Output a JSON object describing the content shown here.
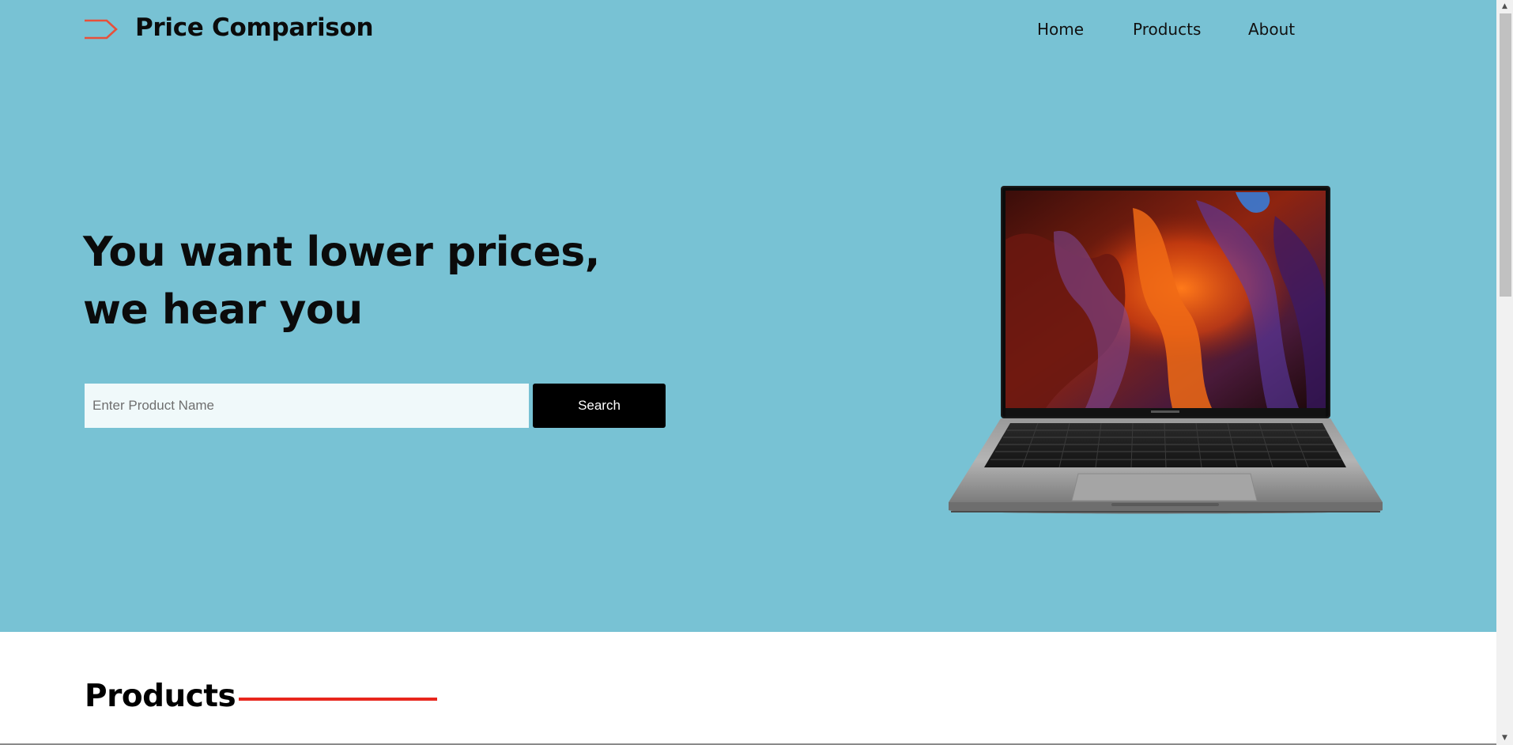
{
  "brand": {
    "name": "Price Comparison",
    "icon": "tag-outline-icon",
    "icon_color": "#e8503a"
  },
  "nav": {
    "items": [
      {
        "label": "Home"
      },
      {
        "label": "Products"
      },
      {
        "label": "About"
      }
    ]
  },
  "hero": {
    "background": "#78c2d4",
    "headline_line1": "You want lower prices,",
    "headline_line2": "we hear you",
    "search": {
      "placeholder": "Enter Product Name",
      "value": "",
      "button_label": "Search"
    },
    "image": "laptop-product-image"
  },
  "products": {
    "heading": "Products",
    "accent_color": "#e8261c"
  },
  "scrollbar": {
    "up_arrow": "▲",
    "down_arrow": "▼"
  }
}
